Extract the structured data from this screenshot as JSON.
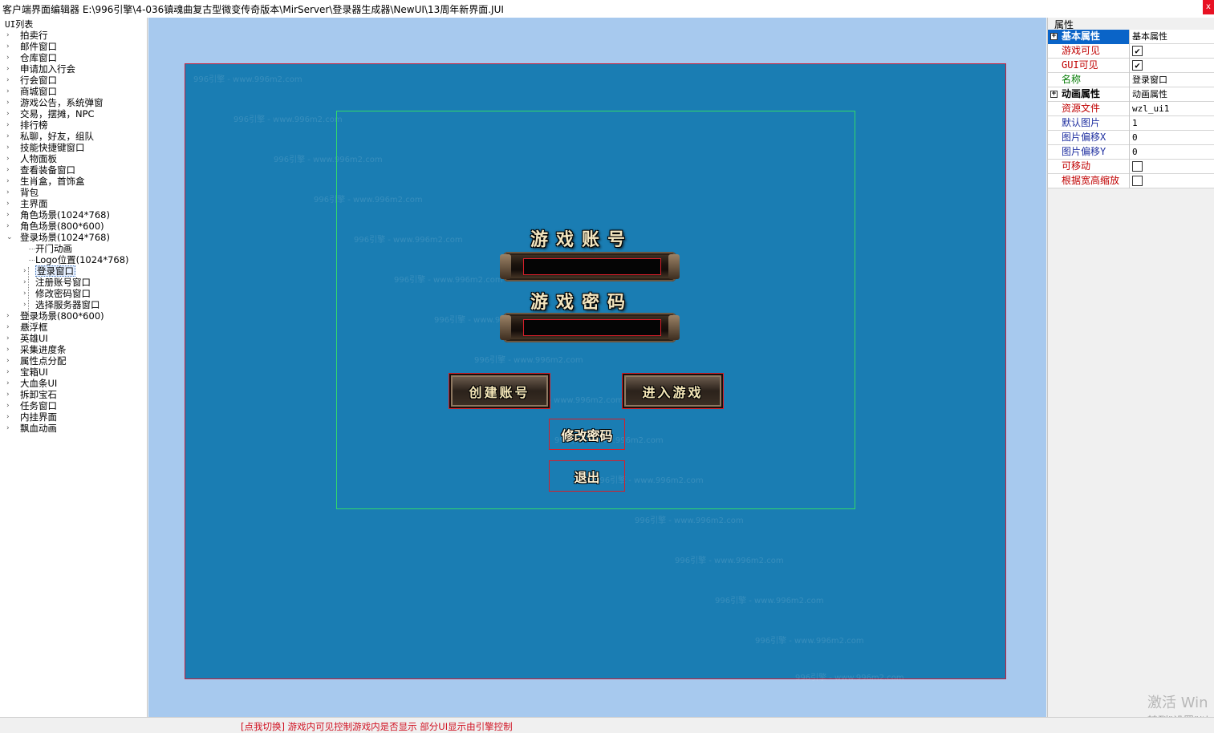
{
  "window": {
    "title": "客户端界面编辑器 E:\\996引擎\\4-036镇魂曲复古型微变传奇版本\\MirServer\\登录器生成器\\NewUI\\13周年新界面.JUI",
    "close_label": "x"
  },
  "tree": {
    "title": "UI列表",
    "items": [
      {
        "label": "拍卖行"
      },
      {
        "label": "邮件窗口"
      },
      {
        "label": "仓库窗口"
      },
      {
        "label": "申请加入行会"
      },
      {
        "label": "行会窗口"
      },
      {
        "label": "商城窗口"
      },
      {
        "label": "游戏公告，系统弹窗"
      },
      {
        "label": "交易，摆摊，NPC"
      },
      {
        "label": "排行榜"
      },
      {
        "label": "私聊，好友，组队"
      },
      {
        "label": "技能快捷键窗口"
      },
      {
        "label": "人物面板"
      },
      {
        "label": "查看装备窗口"
      },
      {
        "label": "生肖盒，首饰盒"
      },
      {
        "label": "背包"
      },
      {
        "label": "主界面"
      },
      {
        "label": "角色场景(1024*768)"
      },
      {
        "label": "角色场景(800*600)"
      },
      {
        "label": "登录场景(1024*768)"
      },
      {
        "label": "开门动画"
      },
      {
        "label": "Logo位置(1024*768)"
      },
      {
        "label": "登录窗口"
      },
      {
        "label": "注册账号窗口"
      },
      {
        "label": "修改密码窗口"
      },
      {
        "label": "选择服务器窗口"
      },
      {
        "label": "登录场景(800*600)"
      },
      {
        "label": "悬浮框"
      },
      {
        "label": "英雄UI"
      },
      {
        "label": "采集进度条"
      },
      {
        "label": "属性点分配"
      },
      {
        "label": "宝箱UI"
      },
      {
        "label": "大血条UI"
      },
      {
        "label": "拆卸宝石"
      },
      {
        "label": "任务窗口"
      },
      {
        "label": "内挂界面"
      },
      {
        "label": "飘血动画"
      }
    ]
  },
  "login": {
    "account_heading": "游戏账号",
    "password_heading": "游戏密码",
    "account_value": "",
    "password_value": "",
    "create_button": "创建账号",
    "enter_button": "进入游戏",
    "change_password_button": "修改密码",
    "exit_button": "退出"
  },
  "properties": {
    "title": "属性",
    "rows": [
      {
        "name": "基本属性",
        "value": "基本属性"
      },
      {
        "name": "游戏可见",
        "value": "✔"
      },
      {
        "name": "GUI可见",
        "value": "✔"
      },
      {
        "name": "名称",
        "value": "登录窗口"
      },
      {
        "name": "动画属性",
        "value": "动画属性"
      },
      {
        "name": "资源文件",
        "value": "wzl_ui1"
      },
      {
        "name": "默认图片",
        "value": "1"
      },
      {
        "name": "图片偏移X",
        "value": "0"
      },
      {
        "name": "图片偏移Y",
        "value": "0"
      },
      {
        "name": "可移动",
        "value": ""
      },
      {
        "name": "根据宽高缩放",
        "value": ""
      }
    ]
  },
  "watermark_text": "996引擎 - www.996m2.com",
  "system": {
    "activate_line1": "激活 Win",
    "activate_line2": "转到\"设置\"以"
  },
  "status": {
    "message": "[点我切换]   游戏内可见控制游戏内是否显示 部分UI显示由引擎控制"
  },
  "colors": {
    "canvas_bg": "#1a7db3",
    "workarea_bg": "#a7c9ee",
    "selection_outline": "#d61f2a",
    "window_outline": "#32d96a"
  }
}
